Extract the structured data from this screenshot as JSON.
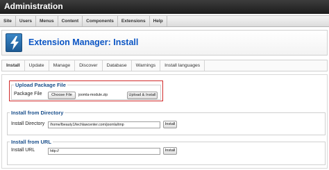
{
  "header": {
    "title": "Administration"
  },
  "menu": {
    "items": [
      "Site",
      "Users",
      "Menus",
      "Content",
      "Components",
      "Extensions",
      "Help"
    ]
  },
  "toolbar": {
    "title": "Extension Manager: Install",
    "icon": "extension-manager-bolt-icon"
  },
  "subtabs": {
    "items": [
      "Install",
      "Update",
      "Manage",
      "Discover",
      "Database",
      "Warnings",
      "Install languages"
    ],
    "active": "Install"
  },
  "upload": {
    "legend": "Upload Package File",
    "label": "Package File",
    "choose_label": "Choose File",
    "file_name": "joomla-module.zip",
    "submit_label": "Upload & Install"
  },
  "directory": {
    "legend": "Install from Directory",
    "label": "Install Directory",
    "value": "/home/lbeauty1/techlawcenter.com/joomla/tmp",
    "submit_label": "Install"
  },
  "url": {
    "legend": "Install from URL",
    "label": "Install URL",
    "value": "http://",
    "submit_label": "Install"
  },
  "colors": {
    "highlight": "#d12a2a",
    "title_blue": "#0b55c4",
    "header_dark": "#1c1c1c"
  }
}
